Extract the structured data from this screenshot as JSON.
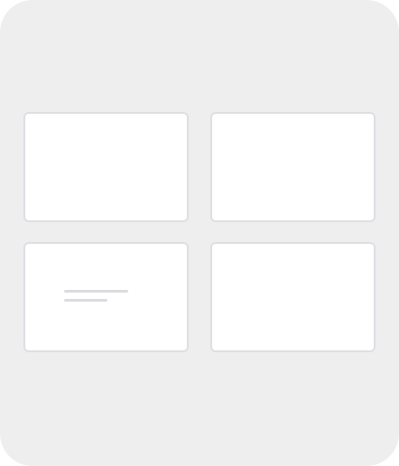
{
  "panel": {
    "cards": [
      {
        "id": "card-1"
      },
      {
        "id": "card-2"
      },
      {
        "id": "card-3",
        "has_placeholder_text": true
      },
      {
        "id": "card-4"
      }
    ]
  },
  "colors": {
    "panel_background": "#eeeeee",
    "card_background": "#ffffff",
    "card_border": "#dedee3",
    "skeleton": "#dcdcdf"
  }
}
